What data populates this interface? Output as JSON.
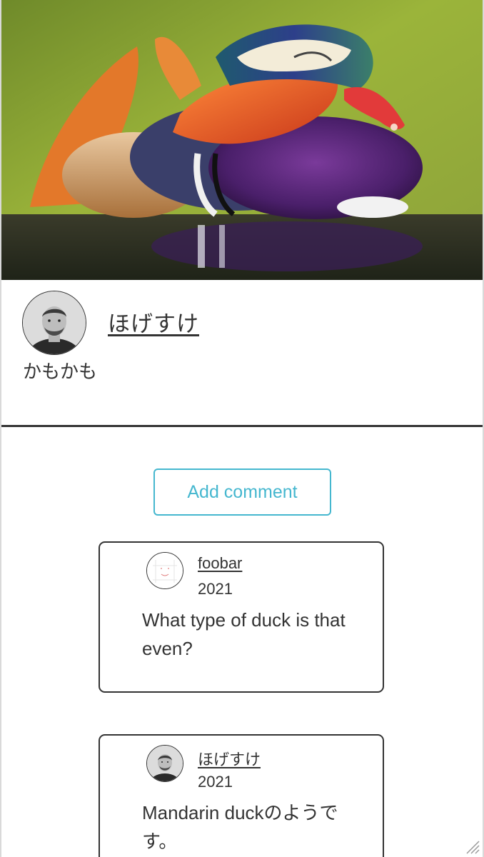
{
  "post": {
    "image_subject": "mandarin duck photo",
    "author": {
      "name": "ほげすけ"
    },
    "caption": "かもかも"
  },
  "actions": {
    "add_comment_label": "Add comment"
  },
  "comments": [
    {
      "author": "foobar",
      "year": "2021",
      "text": "What type of duck is that even?"
    },
    {
      "author": "ほげすけ",
      "year": "2021",
      "text": "Mandarin duckのようです。"
    }
  ],
  "colors": {
    "accent": "#45b7cf",
    "text": "#333333",
    "border": "#333333"
  }
}
